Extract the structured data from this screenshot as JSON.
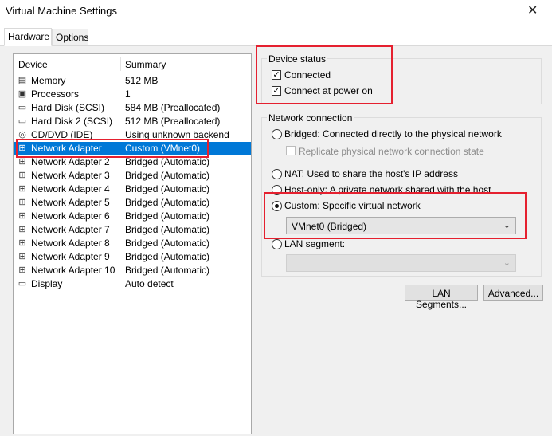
{
  "window": {
    "title": "Virtual Machine Settings",
    "close_glyph": "✕"
  },
  "tabs": [
    {
      "label": "Hardware"
    },
    {
      "label": "Options"
    }
  ],
  "device_list": {
    "columns": {
      "device": "Device",
      "summary": "Summary"
    },
    "rows": [
      {
        "name": "Memory",
        "summary": "512 MB",
        "icon": "memory-icon",
        "glyph": "▤"
      },
      {
        "name": "Processors",
        "summary": "1",
        "icon": "processor-icon",
        "glyph": "▣"
      },
      {
        "name": "Hard Disk (SCSI)",
        "summary": "584 MB (Preallocated)",
        "icon": "hard-disk-icon",
        "glyph": "▭"
      },
      {
        "name": "Hard Disk 2 (SCSI)",
        "summary": "512 MB (Preallocated)",
        "icon": "hard-disk-icon",
        "glyph": "▭"
      },
      {
        "name": "CD/DVD (IDE)",
        "summary": "Using unknown backend",
        "icon": "cd-dvd-icon",
        "glyph": "◎"
      },
      {
        "name": "Network Adapter",
        "summary": "Custom (VMnet0)",
        "icon": "network-adapter-icon",
        "glyph": "⊞"
      },
      {
        "name": "Network Adapter 2",
        "summary": "Bridged (Automatic)",
        "icon": "network-adapter-icon",
        "glyph": "⊞"
      },
      {
        "name": "Network Adapter 3",
        "summary": "Bridged (Automatic)",
        "icon": "network-adapter-icon",
        "glyph": "⊞"
      },
      {
        "name": "Network Adapter 4",
        "summary": "Bridged (Automatic)",
        "icon": "network-adapter-icon",
        "glyph": "⊞"
      },
      {
        "name": "Network Adapter 5",
        "summary": "Bridged (Automatic)",
        "icon": "network-adapter-icon",
        "glyph": "⊞"
      },
      {
        "name": "Network Adapter 6",
        "summary": "Bridged (Automatic)",
        "icon": "network-adapter-icon",
        "glyph": "⊞"
      },
      {
        "name": "Network Adapter 7",
        "summary": "Bridged (Automatic)",
        "icon": "network-adapter-icon",
        "glyph": "⊞"
      },
      {
        "name": "Network Adapter 8",
        "summary": "Bridged (Automatic)",
        "icon": "network-adapter-icon",
        "glyph": "⊞"
      },
      {
        "name": "Network Adapter 9",
        "summary": "Bridged (Automatic)",
        "icon": "network-adapter-icon",
        "glyph": "⊞"
      },
      {
        "name": "Network Adapter 10",
        "summary": "Bridged (Automatic)",
        "icon": "network-adapter-icon",
        "glyph": "⊞"
      },
      {
        "name": "Display",
        "summary": "Auto detect",
        "icon": "display-icon",
        "glyph": "▭"
      }
    ],
    "selected": "Network Adapter"
  },
  "device_status": {
    "label": "Device status",
    "connected": {
      "label": "Connected",
      "checked": true,
      "mark": "✓"
    },
    "connect_at_power_on": {
      "label": "Connect at power on",
      "checked": true,
      "mark": "✓"
    }
  },
  "network_connection": {
    "label": "Network connection",
    "bridged": {
      "label": "Bridged: Connected directly to the physical network",
      "selected": false
    },
    "replicate": {
      "label": "Replicate physical network connection state",
      "checked": false
    },
    "nat": {
      "label": "NAT: Used to share the host's IP address",
      "selected": false
    },
    "host_only": {
      "label": "Host-only: A private network shared with the host",
      "selected": false
    },
    "custom": {
      "label": "Custom: Specific virtual network",
      "selected": true
    },
    "custom_select": {
      "value": "VMnet0 (Bridged)",
      "chevron": "⌄"
    },
    "lan_segment": {
      "label": "LAN segment:",
      "selected": false
    },
    "lan_select": {
      "value": "",
      "chevron": "⌄"
    }
  },
  "buttons": {
    "lan_segments": "LAN Segments...",
    "advanced": "Advanced..."
  },
  "colors": {
    "selection": "#0078d7",
    "highlight_box": "#e5202f",
    "panel_bg": "#f0f0f0"
  }
}
